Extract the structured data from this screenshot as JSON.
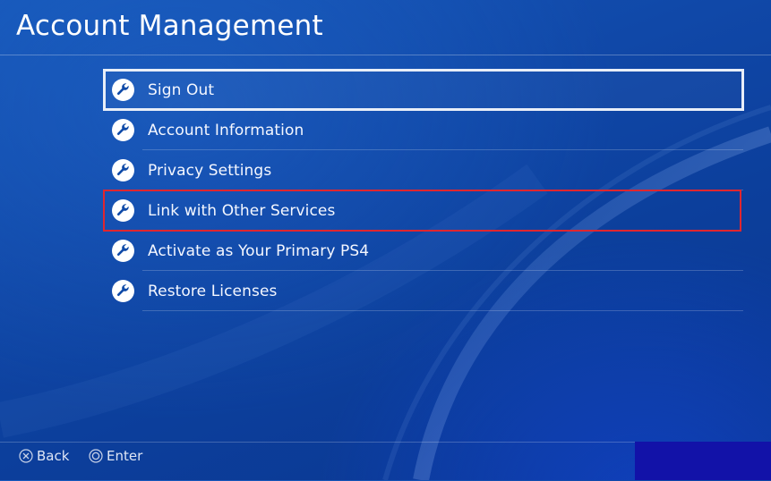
{
  "header": {
    "title": "Account Management"
  },
  "menu": {
    "items": [
      {
        "label": "Sign Out",
        "icon": "wrench-icon",
        "state": "focused"
      },
      {
        "label": "Account Information",
        "icon": "wrench-icon",
        "state": "normal"
      },
      {
        "label": "Privacy Settings",
        "icon": "wrench-icon",
        "state": "normal"
      },
      {
        "label": "Link with Other Services",
        "icon": "wrench-icon",
        "state": "highlighted"
      },
      {
        "label": "Activate as Your Primary PS4",
        "icon": "wrench-icon",
        "state": "normal"
      },
      {
        "label": "Restore Licenses",
        "icon": "wrench-icon",
        "state": "normal"
      }
    ]
  },
  "footer": {
    "back_label": "Back",
    "enter_label": "Enter"
  },
  "colors": {
    "background": "#1048a8",
    "focus_outline": "#e8eef8",
    "highlight_outline": "#e0262f",
    "text": "#ffffff"
  }
}
